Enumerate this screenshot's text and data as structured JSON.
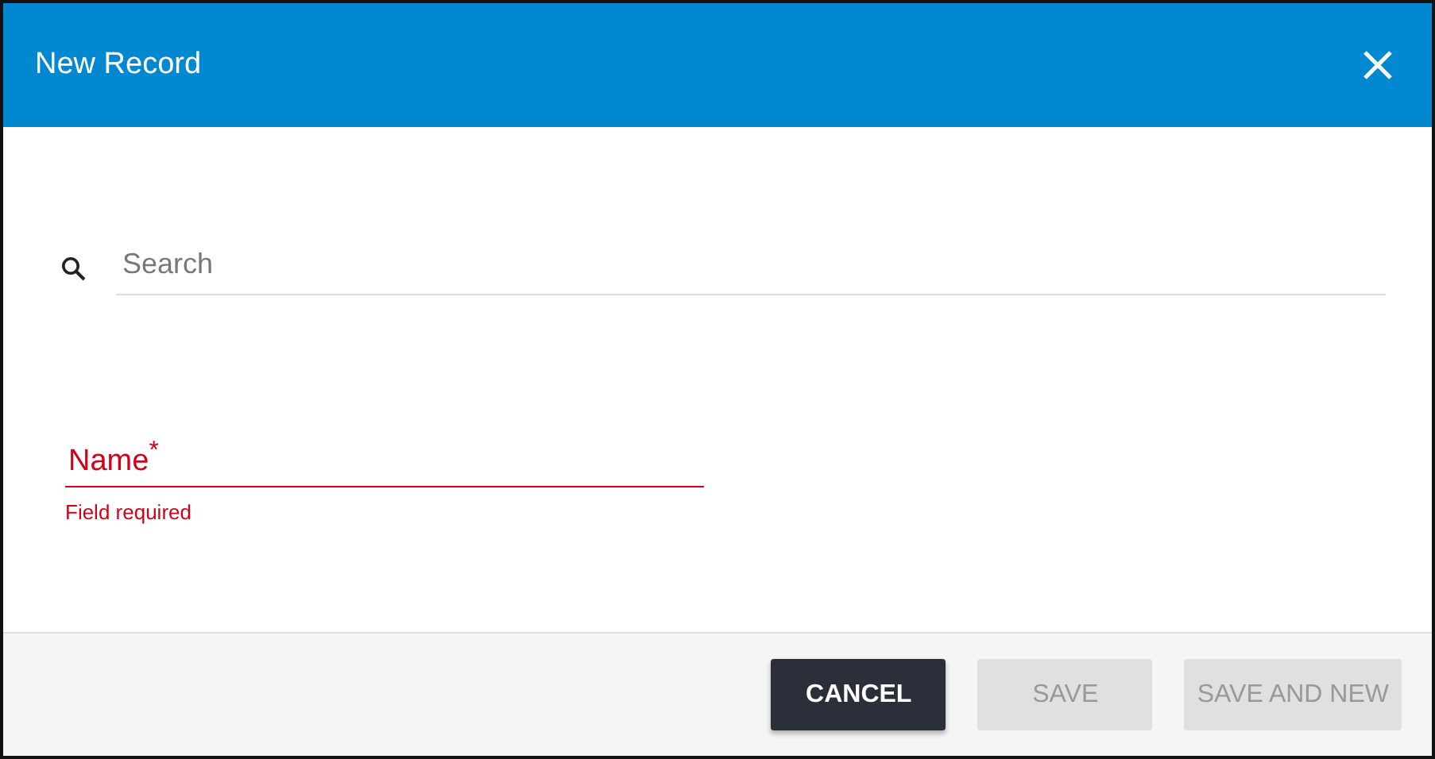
{
  "dialog": {
    "title": "New Record"
  },
  "search": {
    "placeholder": "Search"
  },
  "name_field": {
    "label": "Name$^{*}$",
    "error": "Field required",
    "invalid": true
  },
  "buttons": [
    {
      "label": "CANCEL",
      "disabled": false
    },
    {
      "label": "SAVE",
      "disabled": true
    },
    {
      "label": "SAVE AND NEW",
      "disabled": true
    }
  ]
}
